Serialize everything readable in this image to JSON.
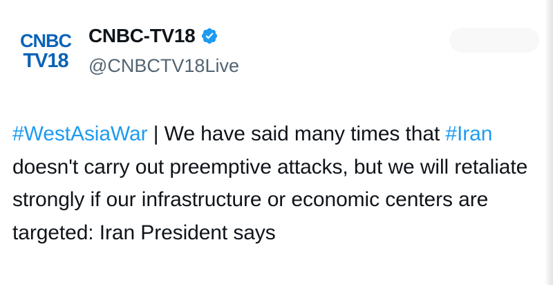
{
  "account": {
    "display_name": "CNBC-TV18",
    "handle": "@CNBCTV18Live",
    "verified_icon": "verified-badge-icon",
    "logo": {
      "line1": "CNBC",
      "line2": "TV18",
      "color": "#0b63b6"
    }
  },
  "tweet": {
    "segments": [
      {
        "text": "#WestAsiaWar",
        "type": "hashtag"
      },
      {
        "text": " | We have said many times that ",
        "type": "text"
      },
      {
        "text": "#Iran",
        "type": "hashtag"
      },
      {
        "text": " doesn't carry out preemptive attacks, but we will retaliate strongly if our infrastructure or economic centers are targeted: Iran President says",
        "type": "text"
      }
    ]
  },
  "colors": {
    "hashtag": "#1d9bf0",
    "text": "#0f1419",
    "secondary": "#536471",
    "verified": "#1d9bf0"
  }
}
